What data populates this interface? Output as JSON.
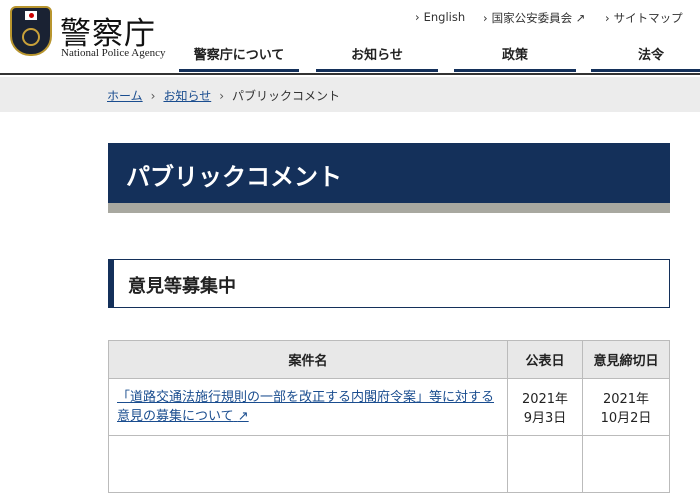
{
  "header": {
    "site_name": "警察庁",
    "site_name_en": "National Police Agency",
    "util_links": [
      {
        "label": "English"
      },
      {
        "label": "国家公安委員会",
        "external": true
      },
      {
        "label": "サイトマップ"
      }
    ],
    "nav": [
      {
        "label": "警察庁について"
      },
      {
        "label": "お知らせ"
      },
      {
        "label": "政策"
      },
      {
        "label": "法令"
      }
    ]
  },
  "breadcrumb": [
    {
      "label": "ホーム"
    },
    {
      "label": "お知らせ"
    },
    {
      "label": "パブリックコメント"
    }
  ],
  "page_title": "パブリックコメント",
  "section_title": "意見等募集中",
  "table": {
    "headers": [
      "案件名",
      "公表日",
      "意見締切日"
    ],
    "rows": [
      {
        "title": "「道路交通法施行規則の一部を改正する内閣府令案」等に対する意見の募集について",
        "published": [
          "2021年",
          "9月3日"
        ],
        "deadline": [
          "2021年",
          "10月2日"
        ]
      }
    ]
  }
}
